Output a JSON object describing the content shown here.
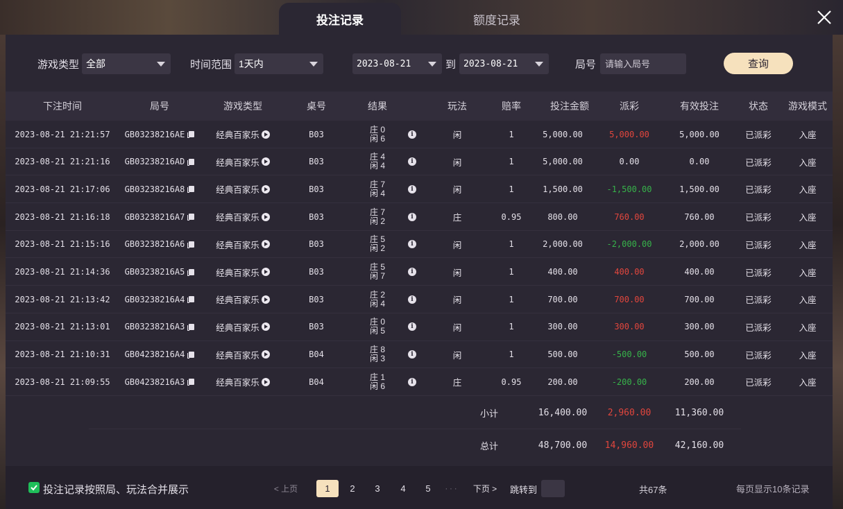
{
  "tabs": [
    {
      "label": "投注记录",
      "active": true
    },
    {
      "label": "额度记录",
      "active": false
    }
  ],
  "filters": {
    "game_type_label": "游戏类型",
    "game_type_value": "全部",
    "time_range_label": "时间范围",
    "time_range_value": "1天内",
    "date_from": "2023-08-21",
    "to_label": "到",
    "date_to": "2023-08-21",
    "round_label": "局号",
    "round_placeholder": "请输入局号",
    "query_label": "查询"
  },
  "columns": [
    "下注时间",
    "局号",
    "游戏类型",
    "桌号",
    "结果",
    "玩法",
    "赔率",
    "投注金额",
    "派彩",
    "有效投注",
    "状态",
    "游戏模式"
  ],
  "rows": [
    {
      "time": "2023-08-21 21:21:57",
      "round": "GB03238216AE",
      "game": "经典百家乐",
      "table": "B03",
      "banker": "庄 0",
      "player": "闲 6",
      "play": "闲",
      "odds": "1",
      "bet": "5,000.00",
      "payout": "5,000.00",
      "payout_type": "red",
      "valid": "5,000.00",
      "status": "已派彩",
      "mode": "入座"
    },
    {
      "time": "2023-08-21 21:21:16",
      "round": "GB03238216AD",
      "game": "经典百家乐",
      "table": "B03",
      "banker": "庄 4",
      "player": "闲 4",
      "play": "闲",
      "odds": "1",
      "bet": "5,000.00",
      "payout": "0.00",
      "payout_type": "neutral",
      "valid": "0.00",
      "status": "已派彩",
      "mode": "入座"
    },
    {
      "time": "2023-08-21 21:17:06",
      "round": "GB03238216A8",
      "game": "经典百家乐",
      "table": "B03",
      "banker": "庄 7",
      "player": "闲 4",
      "play": "闲",
      "odds": "1",
      "bet": "1,500.00",
      "payout": "-1,500.00",
      "payout_type": "green",
      "valid": "1,500.00",
      "status": "已派彩",
      "mode": "入座"
    },
    {
      "time": "2023-08-21 21:16:18",
      "round": "GB03238216A7",
      "game": "经典百家乐",
      "table": "B03",
      "banker": "庄 7",
      "player": "闲 2",
      "play": "庄",
      "odds": "0.95",
      "bet": "800.00",
      "payout": "760.00",
      "payout_type": "red",
      "valid": "760.00",
      "status": "已派彩",
      "mode": "入座"
    },
    {
      "time": "2023-08-21 21:15:16",
      "round": "GB03238216A6",
      "game": "经典百家乐",
      "table": "B03",
      "banker": "庄 5",
      "player": "闲 2",
      "play": "闲",
      "odds": "1",
      "bet": "2,000.00",
      "payout": "-2,000.00",
      "payout_type": "green",
      "valid": "2,000.00",
      "status": "已派彩",
      "mode": "入座"
    },
    {
      "time": "2023-08-21 21:14:36",
      "round": "GB03238216A5",
      "game": "经典百家乐",
      "table": "B03",
      "banker": "庄 5",
      "player": "闲 7",
      "play": "闲",
      "odds": "1",
      "bet": "400.00",
      "payout": "400.00",
      "payout_type": "red",
      "valid": "400.00",
      "status": "已派彩",
      "mode": "入座"
    },
    {
      "time": "2023-08-21 21:13:42",
      "round": "GB03238216A4",
      "game": "经典百家乐",
      "table": "B03",
      "banker": "庄 2",
      "player": "闲 4",
      "play": "闲",
      "odds": "1",
      "bet": "700.00",
      "payout": "700.00",
      "payout_type": "red",
      "valid": "700.00",
      "status": "已派彩",
      "mode": "入座"
    },
    {
      "time": "2023-08-21 21:13:01",
      "round": "GB03238216A3",
      "game": "经典百家乐",
      "table": "B03",
      "banker": "庄 0",
      "player": "闲 5",
      "play": "闲",
      "odds": "1",
      "bet": "300.00",
      "payout": "300.00",
      "payout_type": "red",
      "valid": "300.00",
      "status": "已派彩",
      "mode": "入座"
    },
    {
      "time": "2023-08-21 21:10:31",
      "round": "GB04238216A4",
      "game": "经典百家乐",
      "table": "B04",
      "banker": "庄 8",
      "player": "闲 3",
      "play": "闲",
      "odds": "1",
      "bet": "500.00",
      "payout": "-500.00",
      "payout_type": "green",
      "valid": "500.00",
      "status": "已派彩",
      "mode": "入座"
    },
    {
      "time": "2023-08-21 21:09:55",
      "round": "GB04238216A3",
      "game": "经典百家乐",
      "table": "B04",
      "banker": "庄 1",
      "player": "闲 6",
      "play": "庄",
      "odds": "0.95",
      "bet": "200.00",
      "payout": "-200.00",
      "payout_type": "green",
      "valid": "200.00",
      "status": "已派彩",
      "mode": "入座"
    }
  ],
  "subtotal": {
    "label": "小计",
    "bet": "16,400.00",
    "payout": "2,960.00",
    "valid": "11,360.00"
  },
  "total": {
    "label": "总计",
    "bet": "48,700.00",
    "payout": "14,960.00",
    "valid": "42,160.00"
  },
  "footer": {
    "merge_label": "投注记录按照局、玩法合并展示",
    "merge_checked": true,
    "prev_label": "< 上页",
    "pages": [
      "1",
      "2",
      "3",
      "4",
      "5"
    ],
    "current_page": "1",
    "dots": "· · ·",
    "next_label": "下页 >",
    "jump_label": "跳转到",
    "total_count": "共67条",
    "per_page": "每页显示10条记录"
  },
  "colors": {
    "accent": "#f6e1bd",
    "win": "#e2463d",
    "loss": "#37b34a",
    "checkbox": "#1fbe5a"
  }
}
